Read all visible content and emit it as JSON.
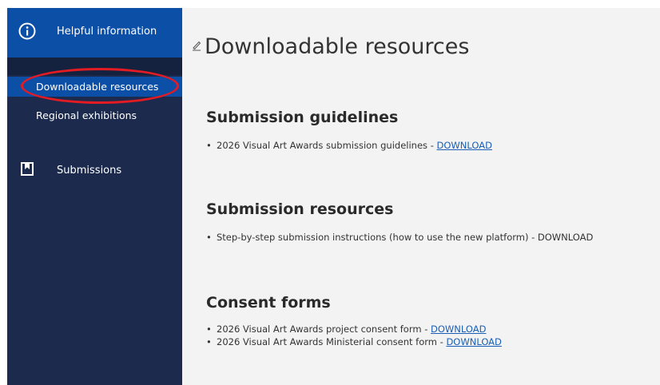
{
  "sidebar": {
    "header_label": "Helpful information",
    "items": [
      {
        "label": "Downloadable resources",
        "active": true
      },
      {
        "label": "Regional exhibitions",
        "active": false
      }
    ],
    "submissions_label": "Submissions"
  },
  "main": {
    "title": "Downloadable resources",
    "sections": [
      {
        "heading": "Submission guidelines",
        "items": [
          {
            "text": "2026 Visual Art Awards submission guidelines - ",
            "link": "DOWNLOAD"
          }
        ]
      },
      {
        "heading": "Submission resources",
        "items": [
          {
            "text": "Step-by-step submission instructions (how to use the new platform) - DOWNLOAD"
          }
        ]
      },
      {
        "heading": "Consent forms",
        "items": [
          {
            "text": "2026 Visual Art Awards project consent form - ",
            "link": "DOWNLOAD"
          },
          {
            "text": "2026 Visual Art Awards Ministerial consent form - ",
            "link": "DOWNLOAD"
          }
        ]
      }
    ]
  },
  "colors": {
    "sidebar_bg": "#1b2a4d",
    "sidebar_active": "#0b4fa6",
    "annotation": "#e31b23",
    "link": "#1a5fb4"
  }
}
